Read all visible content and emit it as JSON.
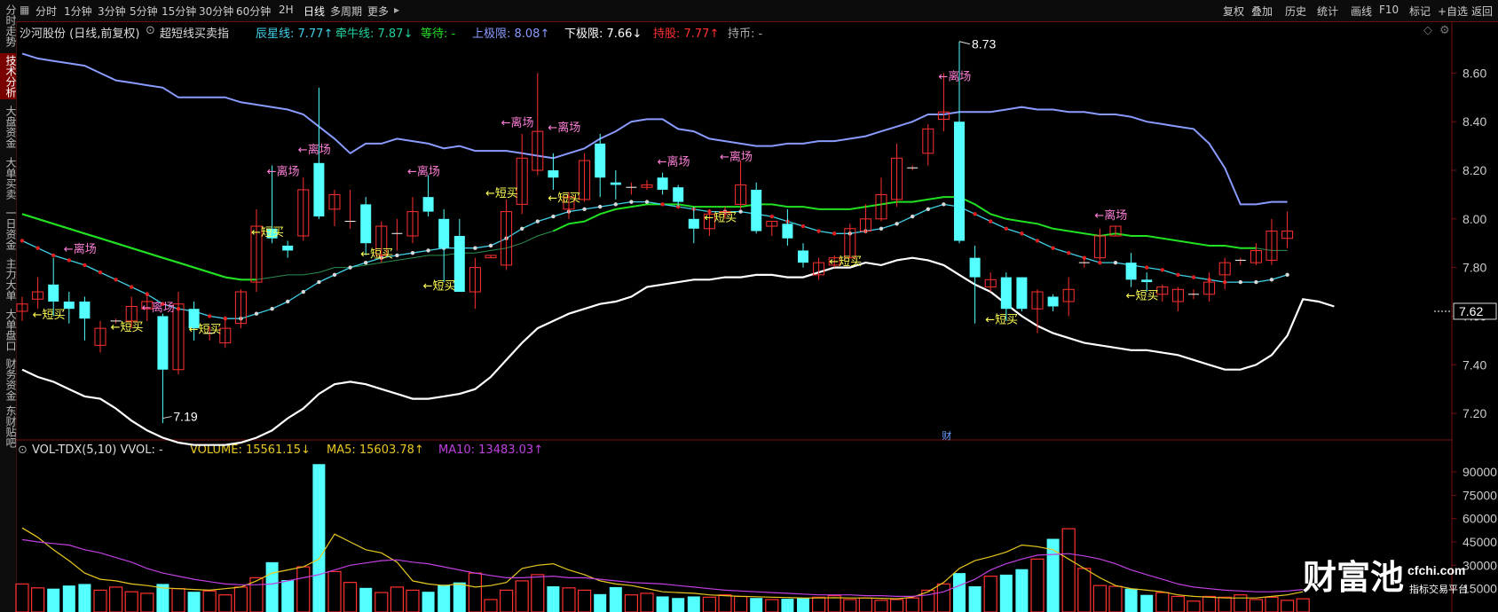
{
  "sidebar": {
    "items": [
      {
        "label": "分时走势",
        "active": false
      },
      {
        "label": "技术分析",
        "active": true
      },
      {
        "label": "大盘资金",
        "active": false
      },
      {
        "label": "大单买卖",
        "active": false
      },
      {
        "label": "一日资金",
        "active": false
      },
      {
        "label": "主力大单",
        "active": false
      },
      {
        "label": "大单盘口",
        "active": false
      },
      {
        "label": "财务资金",
        "active": false
      },
      {
        "label": "东财贴吧",
        "active": false
      }
    ]
  },
  "toolbar": {
    "home_icon": "grid-icon",
    "periods": [
      "分时",
      "1分钟",
      "3分钟",
      "5分钟",
      "15分钟",
      "30分钟",
      "60分钟",
      "2H",
      "日线",
      "多周期",
      "更多"
    ],
    "selected_period": "日线",
    "more_arrow": "▸",
    "right": [
      "复权",
      "叠加",
      "历史",
      "统计",
      "画线",
      "F10",
      "标记",
      "+自选",
      "返回"
    ]
  },
  "info": {
    "stock": "沙河股份 (日线,前复权)",
    "indicator": "超短线买卖指",
    "chenxing": "辰星线: 7.77↑",
    "qianniu": "牵牛线: 7.87↓",
    "dengdai": "等待: -",
    "upper": "上极限: 8.08↑",
    "lower": "下极限: 7.66↓",
    "chigu": "持股: 7.77↑",
    "chibi": "持币: -"
  },
  "vol_info": {
    "name": "VOL-TDX(5,10) VVOL: -",
    "volume": "VOLUME: 15561.15↓",
    "ma5": "MA5: 15603.78↑",
    "ma10": "MA10: 13483.03↑"
  },
  "colors": {
    "up": "#ff3030",
    "down": "#54ffff",
    "upper_band": "#8a9bff",
    "lower_band": "#ffffff",
    "mid_green": "#22e022",
    "cyan_line": "#40d0e8",
    "label_pink": "#ff7fd8",
    "label_yellow": "#ffff55",
    "ma5": "#e8c820",
    "ma10": "#c040e0"
  },
  "price_axis": {
    "ticks": [
      "8.60",
      "8.40",
      "8.20",
      "8.00",
      "7.80",
      "7.60",
      "7.40",
      "7.20"
    ],
    "current": "7.62",
    "min": 7.12,
    "max": 8.74
  },
  "vol_axis": {
    "ticks": [
      "90000",
      "75000",
      "60000",
      "45000",
      "30000",
      "15000"
    ],
    "max": 98000
  },
  "annotations": {
    "high": "8.73",
    "low": "7.19",
    "fin_marker": "财",
    "leave": "←离场",
    "buy_short": "←短买"
  },
  "logo": {
    "main": "财富池",
    "site": "cfchi.com",
    "sub": "指标交易平台"
  },
  "chart_data": {
    "type": "candlestick",
    "candles": [
      [
        7.62,
        7.65,
        7.58,
        7.68
      ],
      [
        7.67,
        7.7,
        7.63,
        7.76
      ],
      [
        7.73,
        7.66,
        7.6,
        7.84
      ],
      [
        7.66,
        7.63,
        7.57,
        7.7
      ],
      [
        7.66,
        7.59,
        7.5,
        7.68
      ],
      [
        7.48,
        7.55,
        7.45,
        7.58
      ],
      [
        7.58,
        7.58,
        7.57,
        7.59
      ],
      [
        7.58,
        7.64,
        7.55,
        7.68
      ],
      [
        7.63,
        7.66,
        7.58,
        7.7
      ],
      [
        7.6,
        7.38,
        7.16,
        7.61
      ],
      [
        7.38,
        7.65,
        7.36,
        7.7
      ],
      [
        7.63,
        7.55,
        7.5,
        7.66
      ],
      [
        7.53,
        7.53,
        7.5,
        7.56
      ],
      [
        7.49,
        7.55,
        7.47,
        7.6
      ],
      [
        7.57,
        7.7,
        7.55,
        7.71
      ],
      [
        7.74,
        7.97,
        7.7,
        8.04
      ],
      [
        7.96,
        7.92,
        7.9,
        8.22
      ],
      [
        7.89,
        7.87,
        7.84,
        7.91
      ],
      [
        7.93,
        8.12,
        7.91,
        8.17
      ],
      [
        8.23,
        8.01,
        8.0,
        8.54
      ],
      [
        8.04,
        8.1,
        7.97,
        8.12
      ],
      [
        7.99,
        7.99,
        7.96,
        8.12
      ],
      [
        8.06,
        7.9,
        7.85,
        8.09
      ],
      [
        7.85,
        7.97,
        7.82,
        7.99
      ],
      [
        7.94,
        7.94,
        7.87,
        8.0
      ],
      [
        7.93,
        8.03,
        7.9,
        8.09
      ],
      [
        8.09,
        8.03,
        8.01,
        8.18
      ],
      [
        8.0,
        7.88,
        7.74,
        8.04
      ],
      [
        7.93,
        7.7,
        7.71,
        8.0
      ],
      [
        7.7,
        7.8,
        7.63,
        7.84
      ],
      [
        7.84,
        7.85,
        7.84,
        7.85
      ],
      [
        7.81,
        8.03,
        7.79,
        8.08
      ],
      [
        8.06,
        8.25,
        8.02,
        8.35
      ],
      [
        8.2,
        8.36,
        8.18,
        8.6
      ],
      [
        8.2,
        8.17,
        8.12,
        8.27
      ],
      [
        8.04,
        8.09,
        8.0,
        8.11
      ],
      [
        8.08,
        8.24,
        8.07,
        8.27
      ],
      [
        8.31,
        8.17,
        8.09,
        8.35
      ],
      [
        8.15,
        8.14,
        8.08,
        8.2
      ],
      [
        8.13,
        8.13,
        8.1,
        8.15
      ],
      [
        8.13,
        8.14,
        8.12,
        8.16
      ],
      [
        8.17,
        8.12,
        8.1,
        8.19
      ],
      [
        8.13,
        8.07,
        8.05,
        8.14
      ],
      [
        8.0,
        7.96,
        7.9,
        8.05
      ],
      [
        7.96,
        8.02,
        7.93,
        8.04
      ],
      [
        8.02,
        8.03,
        8.0,
        8.05
      ],
      [
        8.06,
        8.14,
        8.04,
        8.24
      ],
      [
        8.12,
        7.95,
        7.94,
        8.15
      ],
      [
        7.97,
        7.99,
        7.93,
        7.99
      ],
      [
        7.98,
        7.92,
        7.89,
        8.04
      ],
      [
        7.87,
        7.82,
        7.8,
        7.9
      ],
      [
        7.77,
        7.82,
        7.75,
        7.84
      ],
      [
        7.81,
        7.84,
        7.8,
        7.85
      ],
      [
        7.84,
        7.96,
        7.84,
        7.98
      ],
      [
        7.95,
        8.0,
        7.94,
        8.06
      ],
      [
        8.0,
        8.1,
        7.99,
        8.17
      ],
      [
        8.08,
        8.25,
        8.05,
        8.31
      ],
      [
        8.21,
        8.21,
        8.2,
        8.22
      ],
      [
        8.27,
        8.37,
        8.22,
        8.39
      ],
      [
        8.41,
        8.44,
        8.36,
        8.6
      ],
      [
        8.4,
        7.91,
        7.9,
        8.73
      ],
      [
        7.84,
        7.76,
        7.57,
        7.89
      ],
      [
        7.72,
        7.75,
        7.7,
        7.78
      ],
      [
        7.76,
        7.63,
        7.58,
        7.78
      ],
      [
        7.76,
        7.63,
        7.62,
        7.76
      ],
      [
        7.63,
        7.7,
        7.53,
        7.71
      ],
      [
        7.68,
        7.64,
        7.62,
        7.69
      ],
      [
        7.66,
        7.71,
        7.6,
        7.76
      ],
      [
        7.82,
        7.82,
        7.8,
        7.84
      ],
      [
        7.84,
        7.93,
        7.83,
        7.96
      ],
      [
        7.93,
        7.97,
        7.93,
        7.97
      ],
      [
        7.82,
        7.75,
        7.72,
        7.86
      ],
      [
        7.75,
        7.74,
        7.7,
        7.78
      ],
      [
        7.69,
        7.72,
        7.66,
        7.73
      ],
      [
        7.66,
        7.71,
        7.62,
        7.72
      ],
      [
        7.69,
        7.69,
        7.67,
        7.71
      ],
      [
        7.69,
        7.74,
        7.66,
        7.78
      ],
      [
        7.77,
        7.82,
        7.71,
        7.84
      ],
      [
        7.83,
        7.83,
        7.81,
        7.84
      ],
      [
        7.82,
        7.87,
        7.81,
        7.9
      ],
      [
        7.83,
        7.95,
        7.81,
        8.0
      ],
      [
        7.92,
        7.95,
        7.88,
        8.03
      ]
    ],
    "upper_band": [
      8.68,
      8.66,
      8.65,
      8.64,
      8.63,
      8.6,
      8.57,
      8.56,
      8.55,
      8.54,
      8.5,
      8.5,
      8.5,
      8.5,
      8.48,
      8.47,
      8.46,
      8.45,
      8.43,
      8.38,
      8.33,
      8.27,
      8.31,
      8.31,
      8.33,
      8.32,
      8.31,
      8.29,
      8.3,
      8.28,
      8.28,
      8.28,
      8.27,
      8.26,
      8.25,
      8.27,
      8.29,
      8.33,
      8.36,
      8.4,
      8.41,
      8.41,
      8.37,
      8.36,
      8.33,
      8.32,
      8.31,
      8.3,
      8.3,
      8.31,
      8.31,
      8.32,
      8.32,
      8.33,
      8.34,
      8.36,
      8.38,
      8.4,
      8.43,
      8.43,
      8.44,
      8.44,
      8.44,
      8.45,
      8.46,
      8.45,
      8.45,
      8.44,
      8.44,
      8.43,
      8.43,
      8.42,
      8.4,
      8.39,
      8.38,
      8.37,
      8.31,
      8.21,
      8.06,
      8.06,
      8.07,
      8.07
    ],
    "lower_band": [
      7.38,
      7.35,
      7.33,
      7.3,
      7.27,
      7.26,
      7.22,
      7.17,
      7.13,
      7.1,
      7.08,
      7.07,
      7.07,
      7.07,
      7.08,
      7.1,
      7.13,
      7.18,
      7.22,
      7.28,
      7.32,
      7.33,
      7.32,
      7.3,
      7.28,
      7.26,
      7.26,
      7.27,
      7.28,
      7.3,
      7.35,
      7.42,
      7.49,
      7.55,
      7.58,
      7.61,
      7.63,
      7.65,
      7.66,
      7.68,
      7.72,
      7.73,
      7.74,
      7.75,
      7.75,
      7.76,
      7.76,
      7.77,
      7.77,
      7.76,
      7.76,
      7.78,
      7.8,
      7.8,
      7.82,
      7.81,
      7.83,
      7.84,
      7.83,
      7.81,
      7.77,
      7.73,
      7.7,
      7.65,
      7.6,
      7.56,
      7.53,
      7.51,
      7.49,
      7.48,
      7.47,
      7.46,
      7.46,
      7.45,
      7.44,
      7.42,
      7.4,
      7.38,
      7.38,
      7.4,
      7.44,
      7.52,
      7.67,
      7.66,
      7.64
    ],
    "mid_green": [
      8.02,
      8.0,
      7.98,
      7.96,
      7.94,
      7.92,
      7.9,
      7.88,
      7.86,
      7.84,
      7.82,
      7.8,
      7.78,
      7.76,
      7.75,
      7.75,
      7.76,
      7.77,
      7.77,
      7.78,
      7.8,
      7.8,
      7.81,
      7.82,
      7.83,
      7.84,
      7.85,
      7.85,
      7.86,
      7.86,
      7.87,
      7.88,
      7.9,
      7.93,
      7.95,
      7.98,
      7.99,
      8.02,
      8.04,
      8.05,
      8.06,
      8.06,
      8.06,
      8.05,
      8.05,
      8.05,
      8.05,
      8.06,
      8.06,
      8.05,
      8.05,
      8.04,
      8.04,
      8.04,
      8.05,
      8.06,
      8.07,
      8.07,
      8.08,
      8.09,
      8.09,
      8.06,
      8.02,
      8.0,
      7.99,
      7.98,
      7.96,
      7.95,
      7.94,
      7.93,
      7.94,
      7.93,
      7.93,
      7.92,
      7.91,
      7.9,
      7.89,
      7.89,
      7.88,
      7.88,
      7.87,
      7.87
    ],
    "cyan_line": [
      7.91,
      7.88,
      7.85,
      7.83,
      7.81,
      7.78,
      7.75,
      7.72,
      7.69,
      7.65,
      7.63,
      7.62,
      7.6,
      7.59,
      7.59,
      7.61,
      7.63,
      7.66,
      7.7,
      7.74,
      7.77,
      7.8,
      7.82,
      7.84,
      7.85,
      7.86,
      7.87,
      7.88,
      7.88,
      7.88,
      7.89,
      7.92,
      7.96,
      7.99,
      8.01,
      8.03,
      8.04,
      8.05,
      8.06,
      8.07,
      8.07,
      8.06,
      8.05,
      8.04,
      8.03,
      8.03,
      8.03,
      8.02,
      8.01,
      7.99,
      7.97,
      7.95,
      7.94,
      7.94,
      7.95,
      7.96,
      7.98,
      8.01,
      8.04,
      8.06,
      8.05,
      8.02,
      7.99,
      7.96,
      7.94,
      7.91,
      7.88,
      7.86,
      7.84,
      7.82,
      7.82,
      7.81,
      7.8,
      7.79,
      7.77,
      7.76,
      7.75,
      7.74,
      7.74,
      7.74,
      7.75,
      7.77
    ],
    "volume": [
      18000,
      15500,
      15000,
      17000,
      18000,
      14000,
      16000,
      13000,
      12000,
      18000,
      15000,
      13000,
      13500,
      11000,
      16000,
      22000,
      32000,
      20500,
      29000,
      95000,
      26000,
      19000,
      15500,
      12500,
      16000,
      14000,
      13000,
      17500,
      19000,
      25000,
      8000,
      14000,
      20000,
      24000,
      16500,
      15500,
      14000,
      11500,
      16000,
      11000,
      12000,
      10000,
      9000,
      10000,
      9500,
      11000,
      10000,
      9000,
      8000,
      8500,
      9000,
      9500,
      10500,
      8000,
      9000,
      7500,
      8000,
      9000,
      14000,
      18000,
      25000,
      16500,
      23000,
      24000,
      27500,
      34000,
      47000,
      53500,
      28000,
      17000,
      16500,
      15000,
      11000,
      12500,
      10000,
      7000,
      10000,
      9500,
      11000,
      8000,
      9500,
      7500,
      8500
    ],
    "ma5": [
      54000,
      48000,
      40000,
      33000,
      25000,
      21000,
      20000,
      18000,
      17000,
      15500,
      15000,
      14500,
      14000,
      15000,
      16000,
      20000,
      25000,
      27000,
      29000,
      34000,
      50000,
      45000,
      40000,
      38000,
      32000,
      20000,
      18000,
      17000,
      18000,
      16000,
      17000,
      19000,
      28000,
      30000,
      31000,
      27000,
      24000,
      20000,
      18000,
      17000,
      15000,
      13000,
      12500,
      12000,
      11000,
      10500,
      10000,
      9800,
      9500,
      9300,
      9000,
      9000,
      9200,
      9000,
      9000,
      8800,
      8500,
      9500,
      13000,
      19000,
      28000,
      33000,
      35500,
      38500,
      43000,
      42000,
      40000,
      34000,
      28000,
      22000,
      17000,
      15000,
      14000,
      13000,
      11000,
      10000,
      9500,
      9000,
      9000,
      9000,
      10000,
      11000,
      13000
    ],
    "ma10": [
      46500,
      45000,
      44000,
      43000,
      40000,
      38000,
      35000,
      32000,
      28000,
      25000,
      23000,
      21000,
      19500,
      18000,
      17500,
      17500,
      18000,
      20000,
      22000,
      24000,
      27000,
      30000,
      31500,
      33000,
      33500,
      32000,
      31000,
      29000,
      27000,
      25000,
      23500,
      22000,
      22000,
      22500,
      23000,
      22000,
      22000,
      21000,
      20000,
      19000,
      18500,
      18000,
      17000,
      16000,
      15000,
      14000,
      13500,
      13000,
      12500,
      12000,
      11500,
      11000,
      11000,
      11000,
      10500,
      10500,
      10000,
      10000,
      11000,
      13000,
      17000,
      21000,
      27000,
      31000,
      34000,
      36500,
      37000,
      37500,
      36000,
      34000,
      31000,
      27000,
      24000,
      21000,
      18000,
      16000,
      15000,
      14000,
      13500,
      13000,
      13000,
      13500,
      14500
    ],
    "leave_labels": [
      [
        3,
        7.86
      ],
      [
        8,
        7.62
      ],
      [
        16,
        8.18
      ],
      [
        18,
        8.27
      ],
      [
        25,
        8.18
      ],
      [
        31,
        8.38
      ],
      [
        34,
        8.36
      ],
      [
        41,
        8.22
      ],
      [
        45,
        8.24
      ],
      [
        59,
        8.57
      ],
      [
        69,
        8.0
      ]
    ],
    "buy_labels": [
      [
        1,
        7.59
      ],
      [
        6,
        7.54
      ],
      [
        11,
        7.53
      ],
      [
        15,
        7.93
      ],
      [
        22,
        7.84
      ],
      [
        26,
        7.71
      ],
      [
        30,
        8.09
      ],
      [
        34,
        8.07
      ],
      [
        44,
        7.99
      ],
      [
        52,
        7.81
      ],
      [
        62,
        7.57
      ],
      [
        71,
        7.67
      ]
    ]
  }
}
